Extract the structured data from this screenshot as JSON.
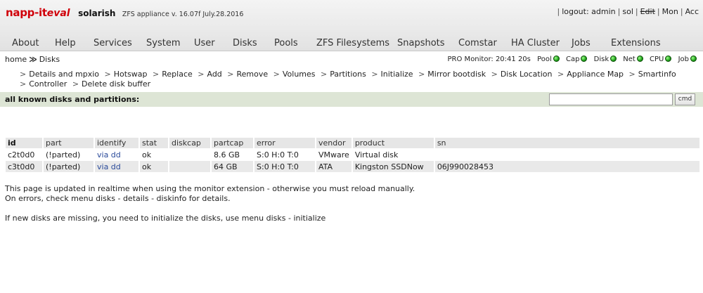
{
  "header": {
    "logo_main": "napp-it",
    "logo_eval": "eval",
    "hostname": "solarish",
    "version": "ZFS appliance v. 16.07f July.28.2016",
    "toplinks": [
      {
        "label": "logout: admin"
      },
      {
        "label": "sol"
      },
      {
        "label": "Edit"
      },
      {
        "label": "Mon"
      },
      {
        "label": "Acc"
      }
    ]
  },
  "nav": {
    "items": [
      "About",
      "Help",
      "Services",
      "System",
      "User",
      "Disks",
      "Pools",
      "ZFS Filesystems",
      "Snapshots",
      "Comstar",
      "HA Cluster",
      "Jobs",
      "Extensions"
    ]
  },
  "breadcrumb": {
    "home": "home",
    "arrow": "≫",
    "current": "Disks"
  },
  "monitor": {
    "label": "PRO Monitor: 20:41 20s",
    "items": [
      "Pool",
      "Cap",
      "Disk",
      "Net",
      "CPU",
      "Job"
    ],
    "led_color": "#1fa11a"
  },
  "submenu": {
    "arrow": ">",
    "items": [
      "Details and mpxio",
      "Hotswap",
      "Replace",
      "Add",
      "Remove",
      "Volumes",
      "Partitions",
      "Initialize",
      "Mirror bootdisk",
      "Disk Location",
      "Appliance Map",
      "Smartinfo",
      "Controller",
      "Delete disk buffer"
    ]
  },
  "section": {
    "title": "all known disks and partitions:",
    "cmd_value": "",
    "cmd_button": "cmd"
  },
  "table": {
    "headers": [
      "id",
      "part",
      "identify",
      "stat",
      "diskcap",
      "partcap",
      "error",
      "vendor",
      "product",
      "sn"
    ],
    "rows": [
      [
        "c2t0d0",
        "(!parted)",
        "via dd",
        "ok",
        "",
        "8.6 GB",
        "S:0 H:0 T:0",
        "VMware",
        "Virtual disk",
        ""
      ],
      [
        "c3t0d0",
        "(!parted)",
        "via dd",
        "ok",
        "",
        "64 GB",
        "S:0 H:0 T:0",
        "ATA",
        "Kingston SSDNow",
        "06J990028453"
      ]
    ]
  },
  "notes": {
    "line1": "This page is updated in realtime when using the monitor extension - otherwise you must reload manually.",
    "line2": "On errors, check menu disks - details - diskinfo for details.",
    "line3": "If new disks are missing, you need to initialize the disks, use menu disks - initialize"
  }
}
